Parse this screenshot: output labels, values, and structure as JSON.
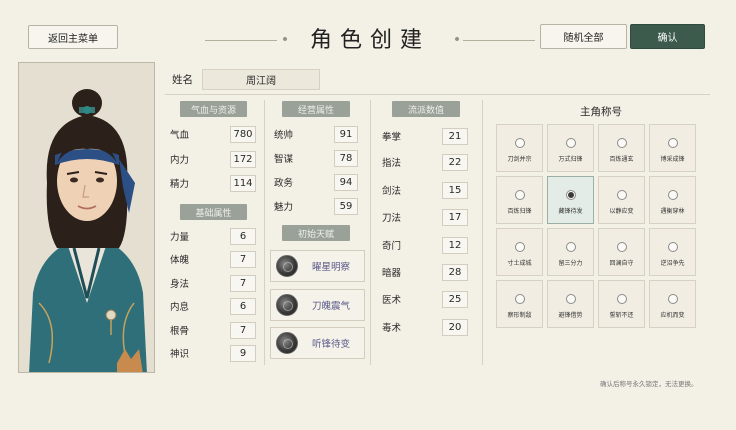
{
  "header": {
    "back_label": "返回主菜单",
    "title": "角色创建",
    "random_label": "随机全部",
    "confirm_label": "确认"
  },
  "name": {
    "label": "姓名",
    "value": "周江阔"
  },
  "groups": {
    "vital": {
      "label": "气血与资源",
      "stats": [
        {
          "label": "气血",
          "value": "780"
        },
        {
          "label": "内力",
          "value": "172"
        },
        {
          "label": "精力",
          "value": "114"
        }
      ]
    },
    "base": {
      "label": "基础属性",
      "stats": [
        {
          "label": "力量",
          "value": "6"
        },
        {
          "label": "体魄",
          "value": "7"
        },
        {
          "label": "身法",
          "value": "7"
        },
        {
          "label": "内息",
          "value": "6"
        },
        {
          "label": "根骨",
          "value": "7"
        },
        {
          "label": "神识",
          "value": "9"
        }
      ]
    },
    "manage": {
      "label": "经营属性",
      "stats": [
        {
          "label": "统帅",
          "value": "91"
        },
        {
          "label": "智谋",
          "value": "78"
        },
        {
          "label": "政务",
          "value": "94"
        },
        {
          "label": "魅力",
          "value": "59"
        }
      ]
    },
    "talent": {
      "label": "初始天赋",
      "items": [
        {
          "name": "曜星明察",
          "icon": "talent-orb-icon"
        },
        {
          "name": "刀魄震气",
          "icon": "talent-orb-icon"
        },
        {
          "name": "听锋待变",
          "icon": "talent-orb-icon"
        }
      ]
    },
    "school": {
      "label": "流派数值",
      "stats": [
        {
          "label": "拳掌",
          "value": "21"
        },
        {
          "label": "指法",
          "value": "22"
        },
        {
          "label": "剑法",
          "value": "15"
        },
        {
          "label": "刀法",
          "value": "17"
        },
        {
          "label": "奇门",
          "value": "12"
        },
        {
          "label": "暗器",
          "value": "28"
        },
        {
          "label": "医术",
          "value": "25"
        },
        {
          "label": "毒术",
          "value": "20"
        }
      ]
    }
  },
  "titles": {
    "label": "主角称号",
    "items": [
      "刀剑并宗",
      "万式归锋",
      "百炼通玄",
      "博采成锋",
      "百炼归锋",
      "藏锋待发",
      "以静应变",
      "遇衡穿林",
      "寸土成城",
      "留三分力",
      "回澜自守",
      "逆沼争先",
      "察形制敌",
      "避锋借势",
      "誓斩不还",
      "应机而变"
    ],
    "selected_index": 5
  },
  "footer_note": "确认后称号永久锁定，无法更换。",
  "colors": {
    "primary": "#3d5b4d",
    "header_pill": "#9aa198",
    "background": "#f3f0e6"
  }
}
